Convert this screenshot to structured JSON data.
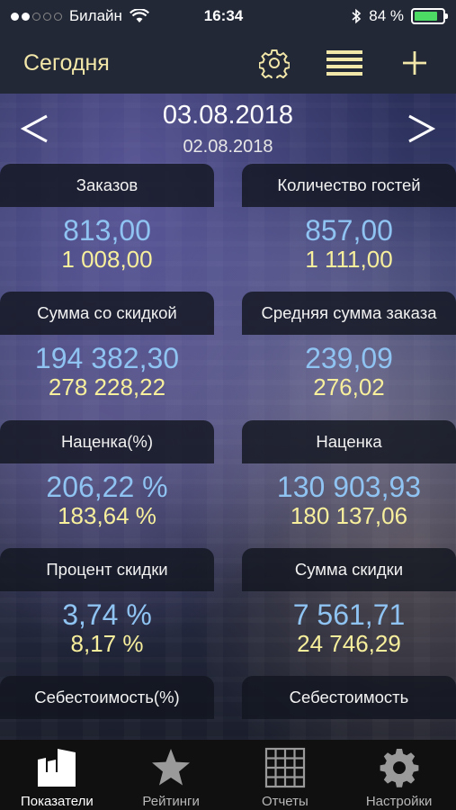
{
  "status_bar": {
    "carrier": "Билайн",
    "time": "16:34",
    "battery": "84 %",
    "battery_level": 0.84
  },
  "nav": {
    "title": "Сегодня",
    "icons": [
      "gear-icon",
      "list-icon",
      "plus-icon"
    ]
  },
  "date": {
    "current": "03.08.2018",
    "previous": "02.08.2018",
    "prev_arrow": "<",
    "next_arrow": ">"
  },
  "cards": [
    {
      "label": "Заказов",
      "value": "813,00",
      "prev": "1 008,00"
    },
    {
      "label": "Количество гостей",
      "value": "857,00",
      "prev": "1 111,00"
    },
    {
      "label": "Сумма со скидкой",
      "value": "194 382,30",
      "prev": "278 228,22"
    },
    {
      "label": "Средняя сумма заказа",
      "value": "239,09",
      "prev": "276,02"
    },
    {
      "label": "Наценка(%)",
      "value": "206,22 %",
      "prev": "183,64 %"
    },
    {
      "label": "Наценка",
      "value": "130 903,93",
      "prev": "180 137,06"
    },
    {
      "label": "Процент скидки",
      "value": "3,74 %",
      "prev": "8,17 %"
    },
    {
      "label": "Сумма скидки",
      "value": "7 561,71",
      "prev": "24 746,29"
    },
    {
      "label": "Себестоимость(%)",
      "value": "",
      "prev": ""
    },
    {
      "label": "Себестоимость",
      "value": "",
      "prev": ""
    }
  ],
  "tabs": [
    {
      "label": "Показатели",
      "icon": "indicators-icon",
      "active": true
    },
    {
      "label": "Рейтинги",
      "icon": "star-icon",
      "active": false
    },
    {
      "label": "Отчеты",
      "icon": "grid-icon",
      "active": false
    },
    {
      "label": "Настройки",
      "icon": "settings-gear-icon",
      "active": false
    }
  ],
  "colors": {
    "accent": "#f2e6a8",
    "value": "#8fc3f2",
    "prev_value": "#f7ef9c",
    "battery": "#4cd964"
  }
}
